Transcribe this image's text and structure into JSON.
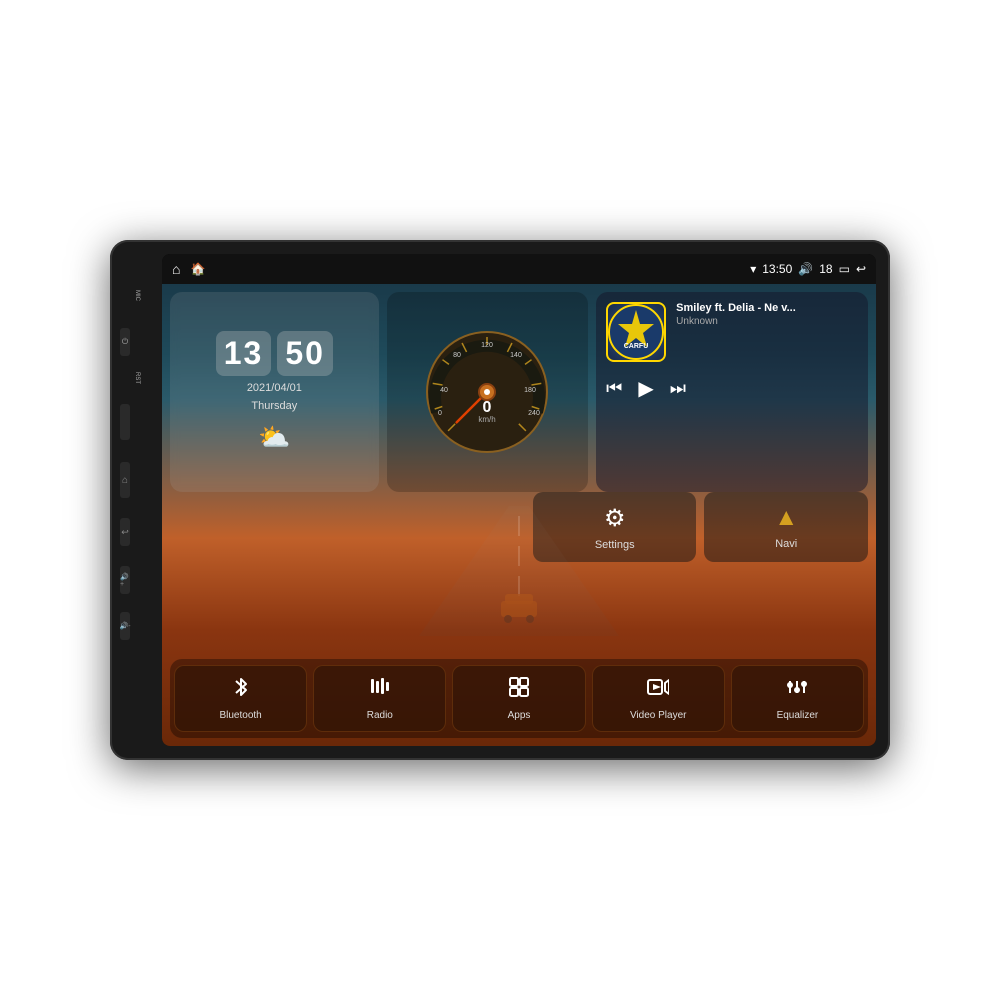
{
  "device": {
    "side_labels": [
      "MIC",
      "RST",
      "",
      "",
      ""
    ]
  },
  "status_bar": {
    "left_icons": [
      "home",
      "android"
    ],
    "time": "13:50",
    "volume": "18",
    "battery": "▭",
    "back": "↩"
  },
  "clock_widget": {
    "time": "13:50",
    "hour": "13",
    "minute": "50",
    "date": "2021/04/01",
    "day": "Thursday",
    "weather_icon": "⛅"
  },
  "speedo_widget": {
    "speed": "0",
    "unit": "km/h",
    "max": "240"
  },
  "music_widget": {
    "title": "Smiley ft. Delia - Ne v...",
    "artist": "Unknown",
    "logo": "CARFU",
    "btn_prev": "⏮",
    "btn_play": "▶",
    "btn_next": "⏭"
  },
  "quick_widgets": [
    {
      "id": "settings",
      "icon": "⚙",
      "label": "Settings"
    },
    {
      "id": "navi",
      "icon": "▲",
      "label": "Navi"
    }
  ],
  "apps": [
    {
      "id": "bluetooth",
      "icon": "bluetooth",
      "label": "Bluetooth"
    },
    {
      "id": "radio",
      "icon": "radio",
      "label": "Radio"
    },
    {
      "id": "apps",
      "icon": "apps",
      "label": "Apps"
    },
    {
      "id": "video",
      "icon": "video",
      "label": "Video Player"
    },
    {
      "id": "equalizer",
      "icon": "equalizer",
      "label": "Equalizer"
    }
  ]
}
